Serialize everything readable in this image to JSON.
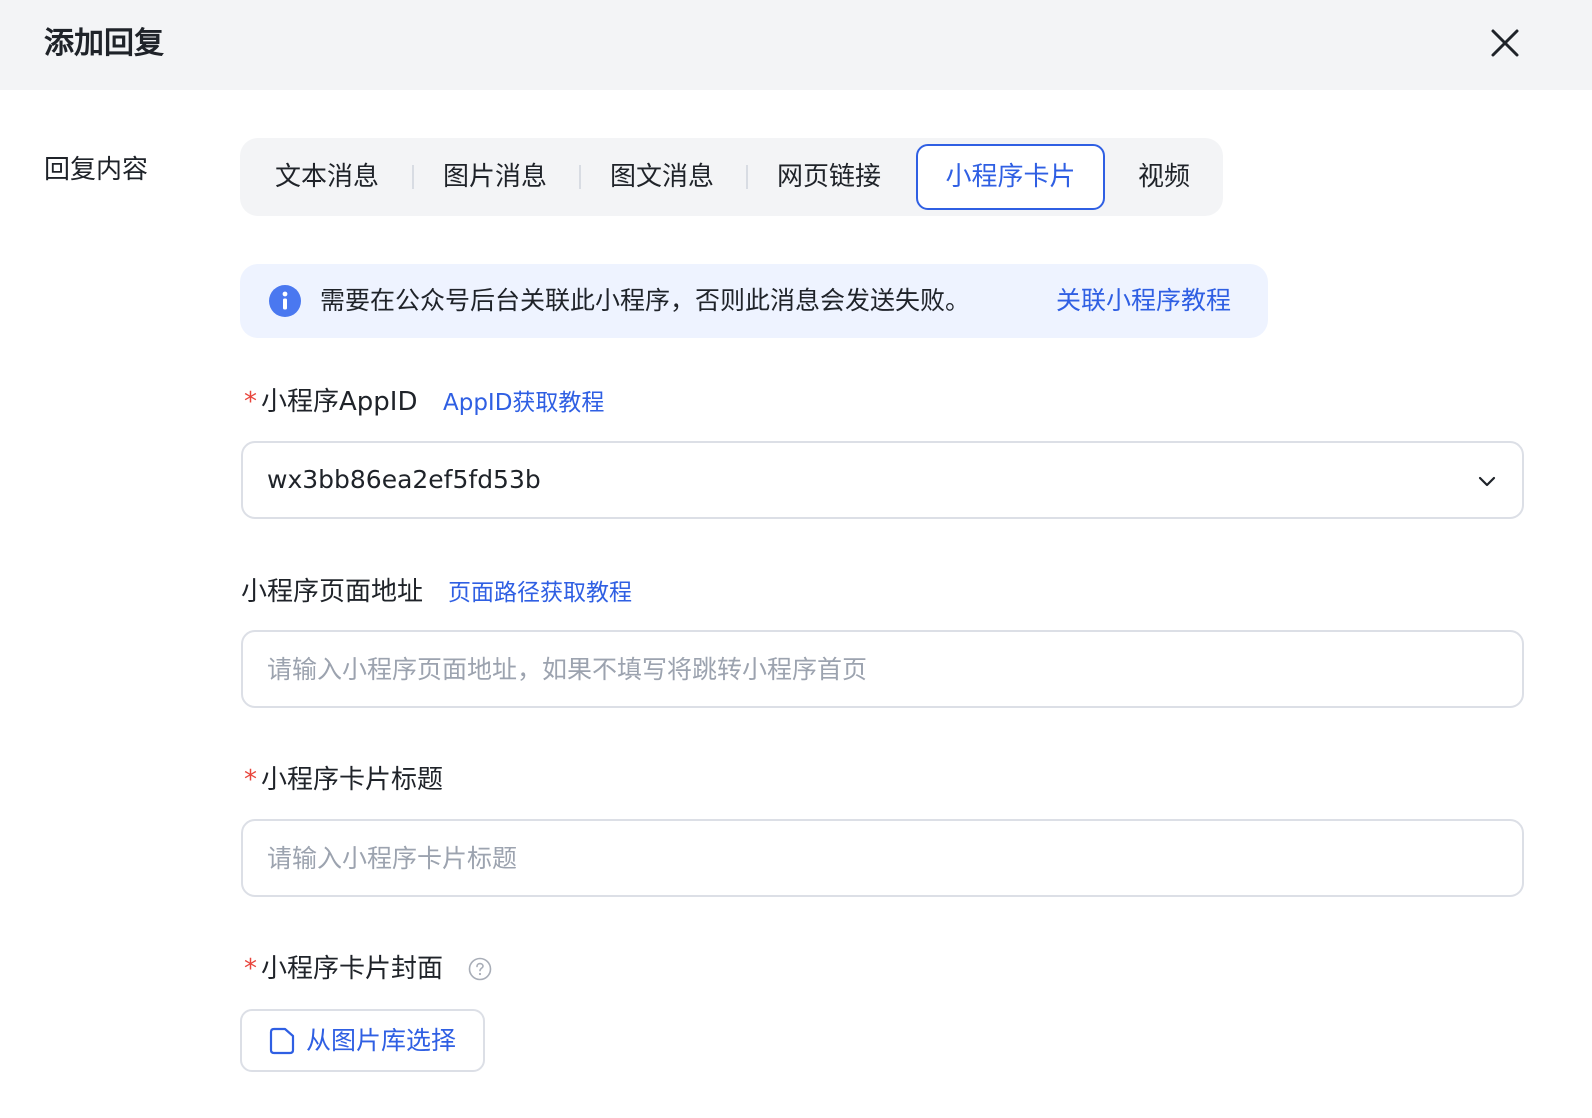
{
  "dialog": {
    "title": "添加回复"
  },
  "reply_content": {
    "label": "回复内容",
    "tabs": [
      {
        "label": "文本消息",
        "active": false
      },
      {
        "label": "图片消息",
        "active": false
      },
      {
        "label": "图文消息",
        "active": false
      },
      {
        "label": "网页链接",
        "active": false
      },
      {
        "label": "小程序卡片",
        "active": true
      },
      {
        "label": "视频",
        "active": false
      }
    ]
  },
  "notice": {
    "icon": "info-icon",
    "text": "需要在公众号后台关联此小程序，否则此消息会发送失败。",
    "link": "关联小程序教程"
  },
  "fields": {
    "appid": {
      "required_mark": "*",
      "label": "小程序AppID",
      "link": "AppID获取教程",
      "value": "wx3bb86ea2ef5fd53b"
    },
    "page_path": {
      "label": "小程序页面地址",
      "link": "页面路径获取教程",
      "placeholder": "请输入小程序页面地址，如果不填写将跳转小程序首页",
      "value": ""
    },
    "card_title": {
      "required_mark": "*",
      "label": "小程序卡片标题",
      "placeholder": "请输入小程序卡片标题",
      "value": ""
    },
    "card_cover": {
      "required_mark": "*",
      "label": "小程序卡片封面",
      "upload_label": "从图片库选择"
    }
  },
  "colors": {
    "accent": "#2f5fe3",
    "required": "#e8453c",
    "notice_bg": "#eef3ff",
    "header_bg": "#f3f4f6"
  }
}
